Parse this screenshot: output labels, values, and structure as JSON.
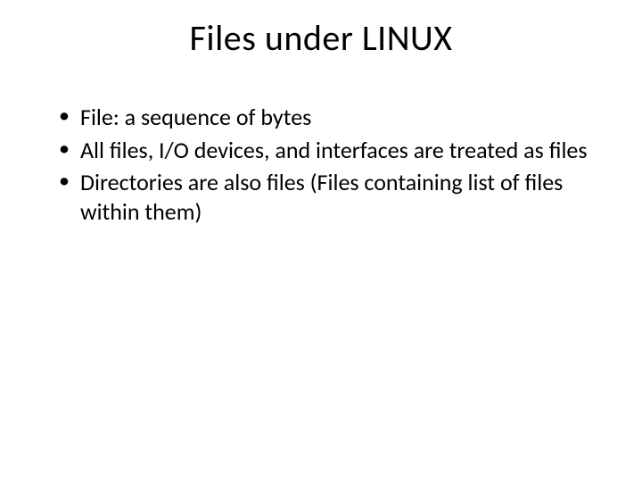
{
  "slide": {
    "title": "Files under LINUX",
    "bullets": [
      "File: a sequence of bytes",
      "All files, I/O devices, and interfaces are treated as files",
      "Directories are also files (Files containing list of files within them)"
    ]
  }
}
